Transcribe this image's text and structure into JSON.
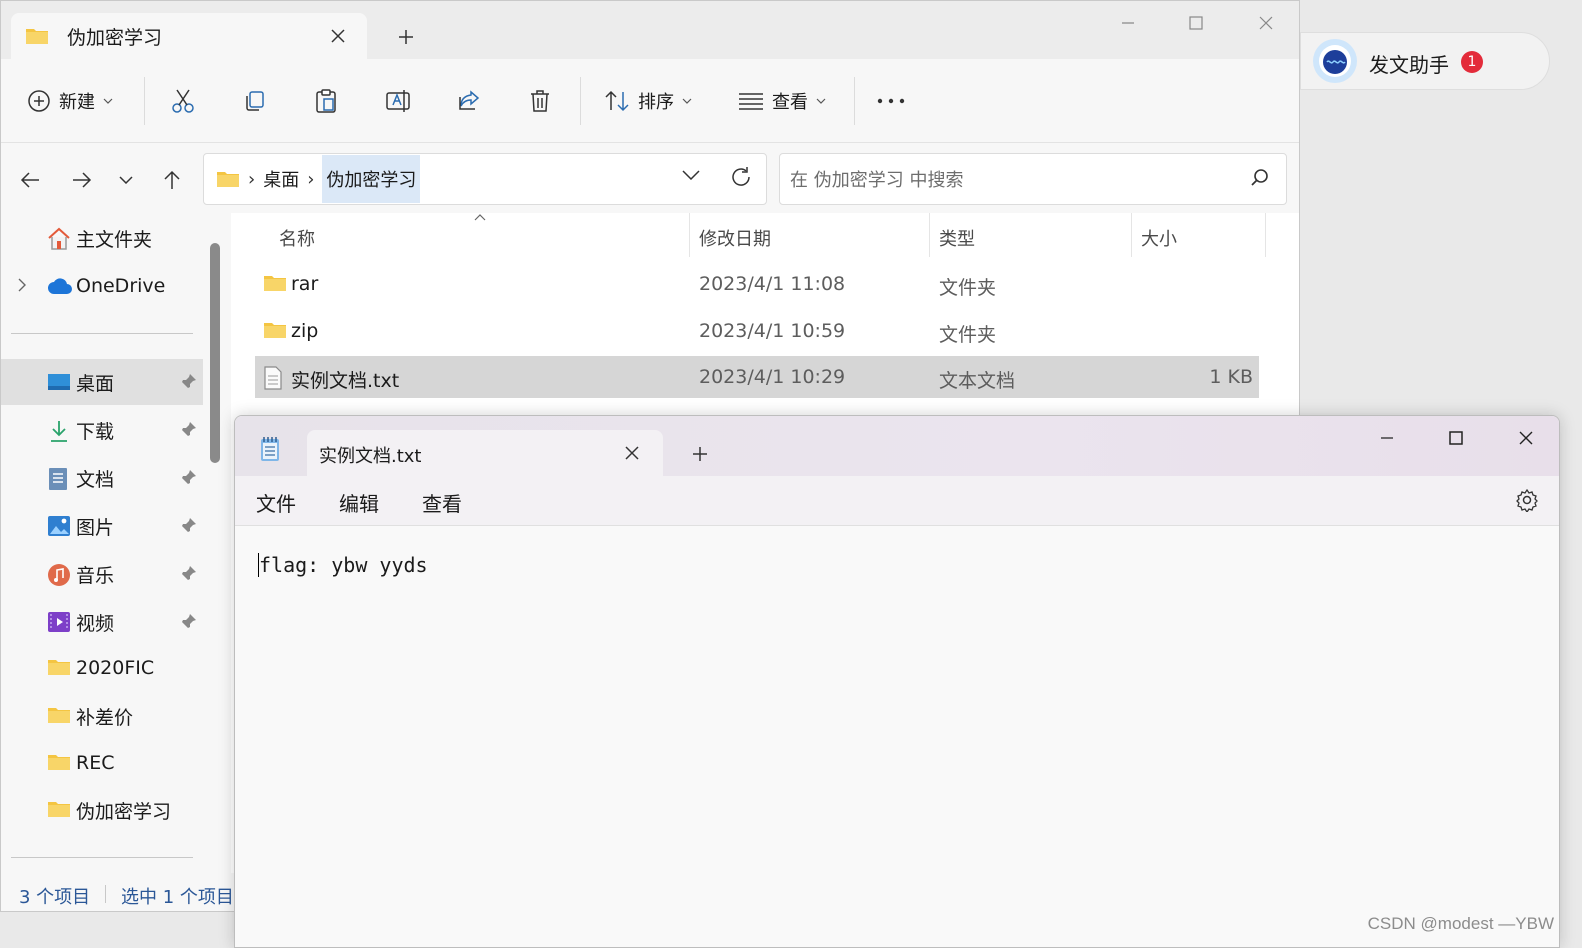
{
  "explorer": {
    "tab_title": "伪加密学习",
    "toolbar": {
      "new_label": "新建",
      "sort_label": "排序",
      "view_label": "查看"
    },
    "breadcrumb": [
      "桌面",
      "伪加密学习"
    ],
    "search_placeholder": "在 伪加密学习 中搜索",
    "columns": {
      "name": "名称",
      "date": "修改日期",
      "type": "类型",
      "size": "大小"
    },
    "files": [
      {
        "name": "rar",
        "date": "2023/4/1 11:08",
        "type": "文件夹",
        "size": "",
        "icon": "folder-icon"
      },
      {
        "name": "zip",
        "date": "2023/4/1 10:59",
        "type": "文件夹",
        "size": "",
        "icon": "folder-icon"
      },
      {
        "name": "实例文档.txt",
        "date": "2023/4/1 10:29",
        "type": "文本文档",
        "size": "1 KB",
        "icon": "text-file-icon",
        "selected": true
      }
    ],
    "sidebar": {
      "top": [
        {
          "label": "主文件夹",
          "icon": "home-icon"
        },
        {
          "label": "OneDrive",
          "icon": "cloud-icon"
        }
      ],
      "pinned": [
        {
          "label": "桌面",
          "icon": "desktop-icon",
          "selected": true
        },
        {
          "label": "下载",
          "icon": "download-icon"
        },
        {
          "label": "文档",
          "icon": "document-icon"
        },
        {
          "label": "图片",
          "icon": "pictures-icon"
        },
        {
          "label": "音乐",
          "icon": "music-icon"
        },
        {
          "label": "视频",
          "icon": "video-icon"
        }
      ],
      "folders": [
        "2020FIC",
        "补差价",
        "REC",
        "伪加密学习"
      ]
    },
    "status": {
      "count": "3 个项目",
      "selected": "选中 1 个项目"
    }
  },
  "notepad": {
    "tab_title": "实例文档.txt",
    "menu": [
      "文件",
      "编辑",
      "查看"
    ],
    "content": "flag: ybw yyds"
  },
  "assistant": {
    "label": "发文助手",
    "badge": "1"
  },
  "watermark": "CSDN @modest —YBW",
  "colors": {
    "folder": "#f4c542",
    "accent": "#0067c0",
    "badge": "#e32b3a"
  }
}
